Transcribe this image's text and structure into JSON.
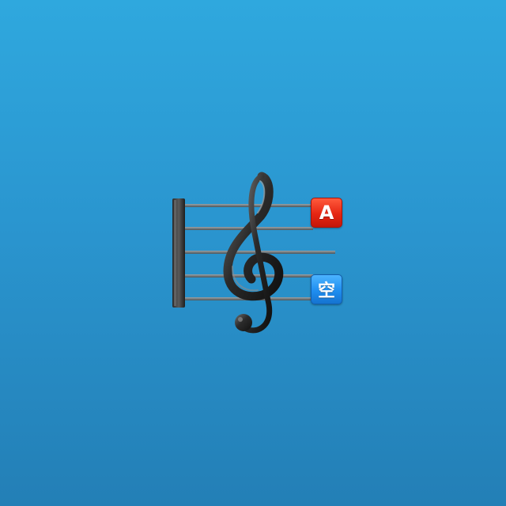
{
  "emoji": {
    "name": "musical-score-emoji",
    "icon": "treble-clef-staff-icon",
    "badges": [
      {
        "name": "letter-a-badge",
        "text": "A",
        "color": "#e52612"
      },
      {
        "name": "vacancy-badge",
        "text": "空",
        "color": "#1f8ef0"
      }
    ]
  },
  "background": {
    "color_top": "#2fa8de",
    "color_bottom": "#237fb6"
  }
}
